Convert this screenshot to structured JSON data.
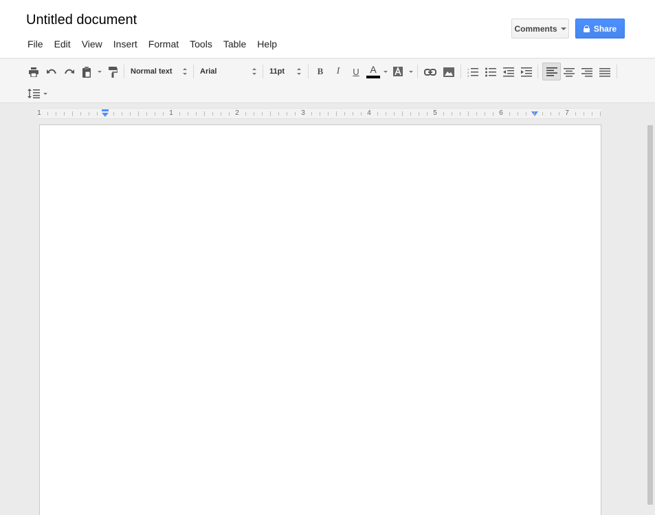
{
  "document": {
    "title": "Untitled document"
  },
  "menu": [
    "File",
    "Edit",
    "View",
    "Insert",
    "Format",
    "Tools",
    "Table",
    "Help"
  ],
  "header_buttons": {
    "comments_label": "Comments",
    "share_label": "Share"
  },
  "toolbar": {
    "style": "Normal text",
    "font": "Arial",
    "size": "11pt",
    "text_color": "#000000",
    "active_alignment": "align-left"
  },
  "ruler": {
    "labels": [
      "1",
      "1",
      "2",
      "3",
      "4",
      "5",
      "6",
      "7"
    ]
  },
  "colors": {
    "share_blue": "#4d90fe",
    "indent_marker": "#4d90fe",
    "page_bg": "#ffffff",
    "workspace_bg": "#ebebeb"
  }
}
